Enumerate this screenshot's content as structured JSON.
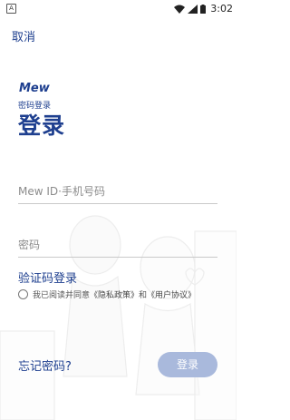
{
  "status_bar": {
    "time": "3:02",
    "left_icon_letter": "A"
  },
  "header": {
    "cancel_label": "取消"
  },
  "brand": {
    "logo_text": "Mew"
  },
  "login": {
    "subtitle": "密码登录",
    "title": "登录",
    "id_placeholder": "Mew ID·手机号码",
    "password_placeholder": "密码",
    "sms_login_label": "验证码登录",
    "agreement_prefix": "我已阅读并同意",
    "privacy_policy": "《隐私政策》",
    "conjunction": "和",
    "user_agreement": "《用户协议》",
    "forgot_label": "忘记密码?",
    "login_button": "登录"
  },
  "colors": {
    "primary": "#1e3f8f",
    "button_disabled": "#a9b9dc"
  }
}
